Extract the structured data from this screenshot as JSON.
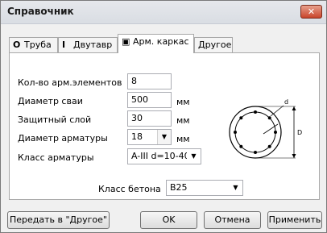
{
  "window": {
    "title": "Справочник",
    "close_glyph": "✕"
  },
  "tabs": [
    {
      "label": "Труба",
      "icon": "O"
    },
    {
      "label": "Двутавр",
      "icon": "I"
    },
    {
      "label": "Арм. каркас",
      "icon": "▣"
    },
    {
      "label": "Другое"
    }
  ],
  "form": {
    "count_label": "Кол-во арм.элементов",
    "count_value": "8",
    "diameter_label": "Диаметр сваи",
    "diameter_value": "500",
    "diameter_unit": "мм",
    "cover_label": "Защитный слой",
    "cover_value": "30",
    "cover_unit": "мм",
    "rebar_diam_label": "Диаметр арматуры",
    "rebar_diam_value": "18",
    "rebar_diam_unit": "мм",
    "rebar_class_label": "Класс арматуры",
    "rebar_class_value": "A-III d=10-40",
    "concrete_label": "Класс бетона",
    "concrete_value": "B25"
  },
  "diagram": {
    "d_label": "d",
    "D_label": "D"
  },
  "buttons": {
    "transfer": "Передать в \"Другое\"",
    "ok": "OK",
    "cancel": "Отмена",
    "apply": "Применить"
  }
}
